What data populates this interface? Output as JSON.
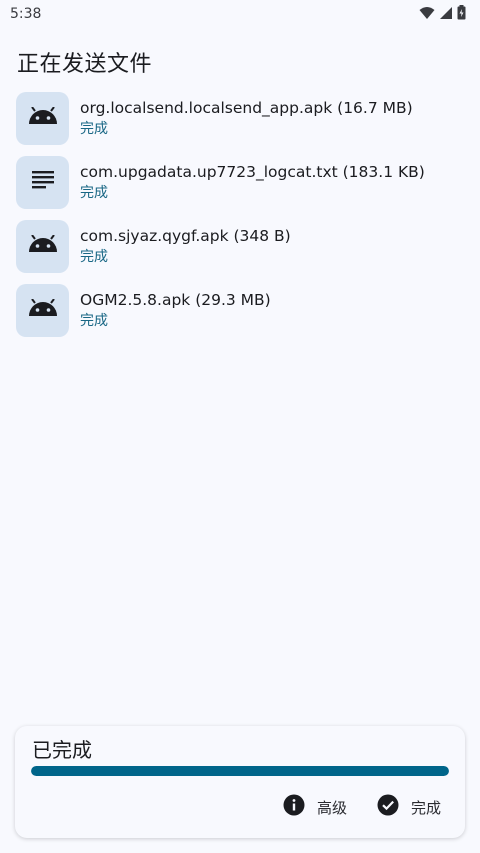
{
  "status_bar": {
    "time": "5:38",
    "icons": [
      "wifi-icon",
      "signal-icon",
      "battery-charging-icon"
    ]
  },
  "page_title": "正在发送文件",
  "files": [
    {
      "name": "org.localsend.localsend_app.apk (16.7 MB)",
      "status": "完成",
      "icon": "android-icon"
    },
    {
      "name": "com.upgadata.up7723_logcat.txt (183.1 KB)",
      "status": "完成",
      "icon": "text-file-icon"
    },
    {
      "name": "com.sjyaz.qygf.apk (348 B)",
      "status": "完成",
      "icon": "android-icon"
    },
    {
      "name": "OGM2.5.8.apk (29.3 MB)",
      "status": "完成",
      "icon": "android-icon"
    }
  ],
  "progress_card": {
    "title": "已完成",
    "progress_fraction": 1.0,
    "advanced_label": "高级",
    "done_label": "完成"
  },
  "colors": {
    "background": "#f8f9fe",
    "icon_box": "#d6e3f2",
    "accent": "#00658a",
    "status_text": "#196785"
  }
}
